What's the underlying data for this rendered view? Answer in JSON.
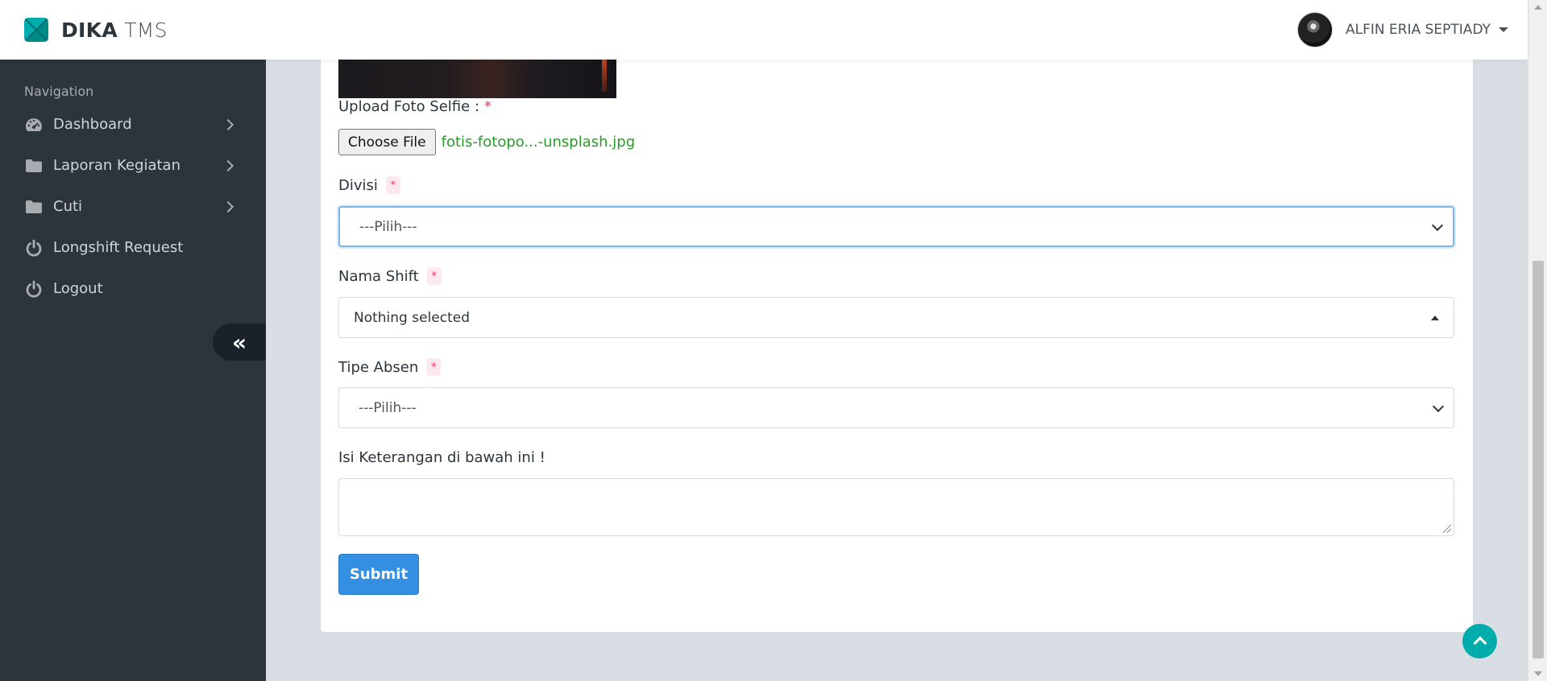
{
  "header": {
    "brand_bold": "DIKA",
    "brand_light": "TMS",
    "user_name": "ALFIN ERIA SEPTIADY"
  },
  "sidebar": {
    "nav_header": "Navigation",
    "items": [
      {
        "label": "Dashboard",
        "icon": "dashboard-gauge-icon",
        "has_submenu": true
      },
      {
        "label": "Laporan Kegiatan",
        "icon": "folder-icon",
        "has_submenu": true
      },
      {
        "label": "Cuti",
        "icon": "folder-icon",
        "has_submenu": true
      },
      {
        "label": "Longshift Request",
        "icon": "power-icon",
        "has_submenu": false
      },
      {
        "label": "Logout",
        "icon": "power-icon",
        "has_submenu": false
      }
    ],
    "minify_label": "«"
  },
  "form": {
    "upload_label": "Upload Foto Selfie :",
    "required_mark": "*",
    "choose_file_label": "Choose File",
    "file_name": "fotis-fotopo...-unsplash.jpg",
    "divisi_label": "Divisi",
    "divisi_value": "---Pilih---",
    "nama_shift_label": "Nama Shift",
    "nama_shift_value": "Nothing selected",
    "tipe_absen_label": "Tipe Absen",
    "tipe_absen_value": "---Pilih---",
    "keterangan_label": "Isi Keterangan di bawah ini !",
    "keterangan_value": "",
    "submit_label": "Submit"
  },
  "colors": {
    "sidebar_bg": "#2d353c",
    "accent_teal": "#00acac",
    "primary_blue": "#348fe2",
    "required_pink": "#ff2e58",
    "file_name_green": "#2a9a2a"
  }
}
